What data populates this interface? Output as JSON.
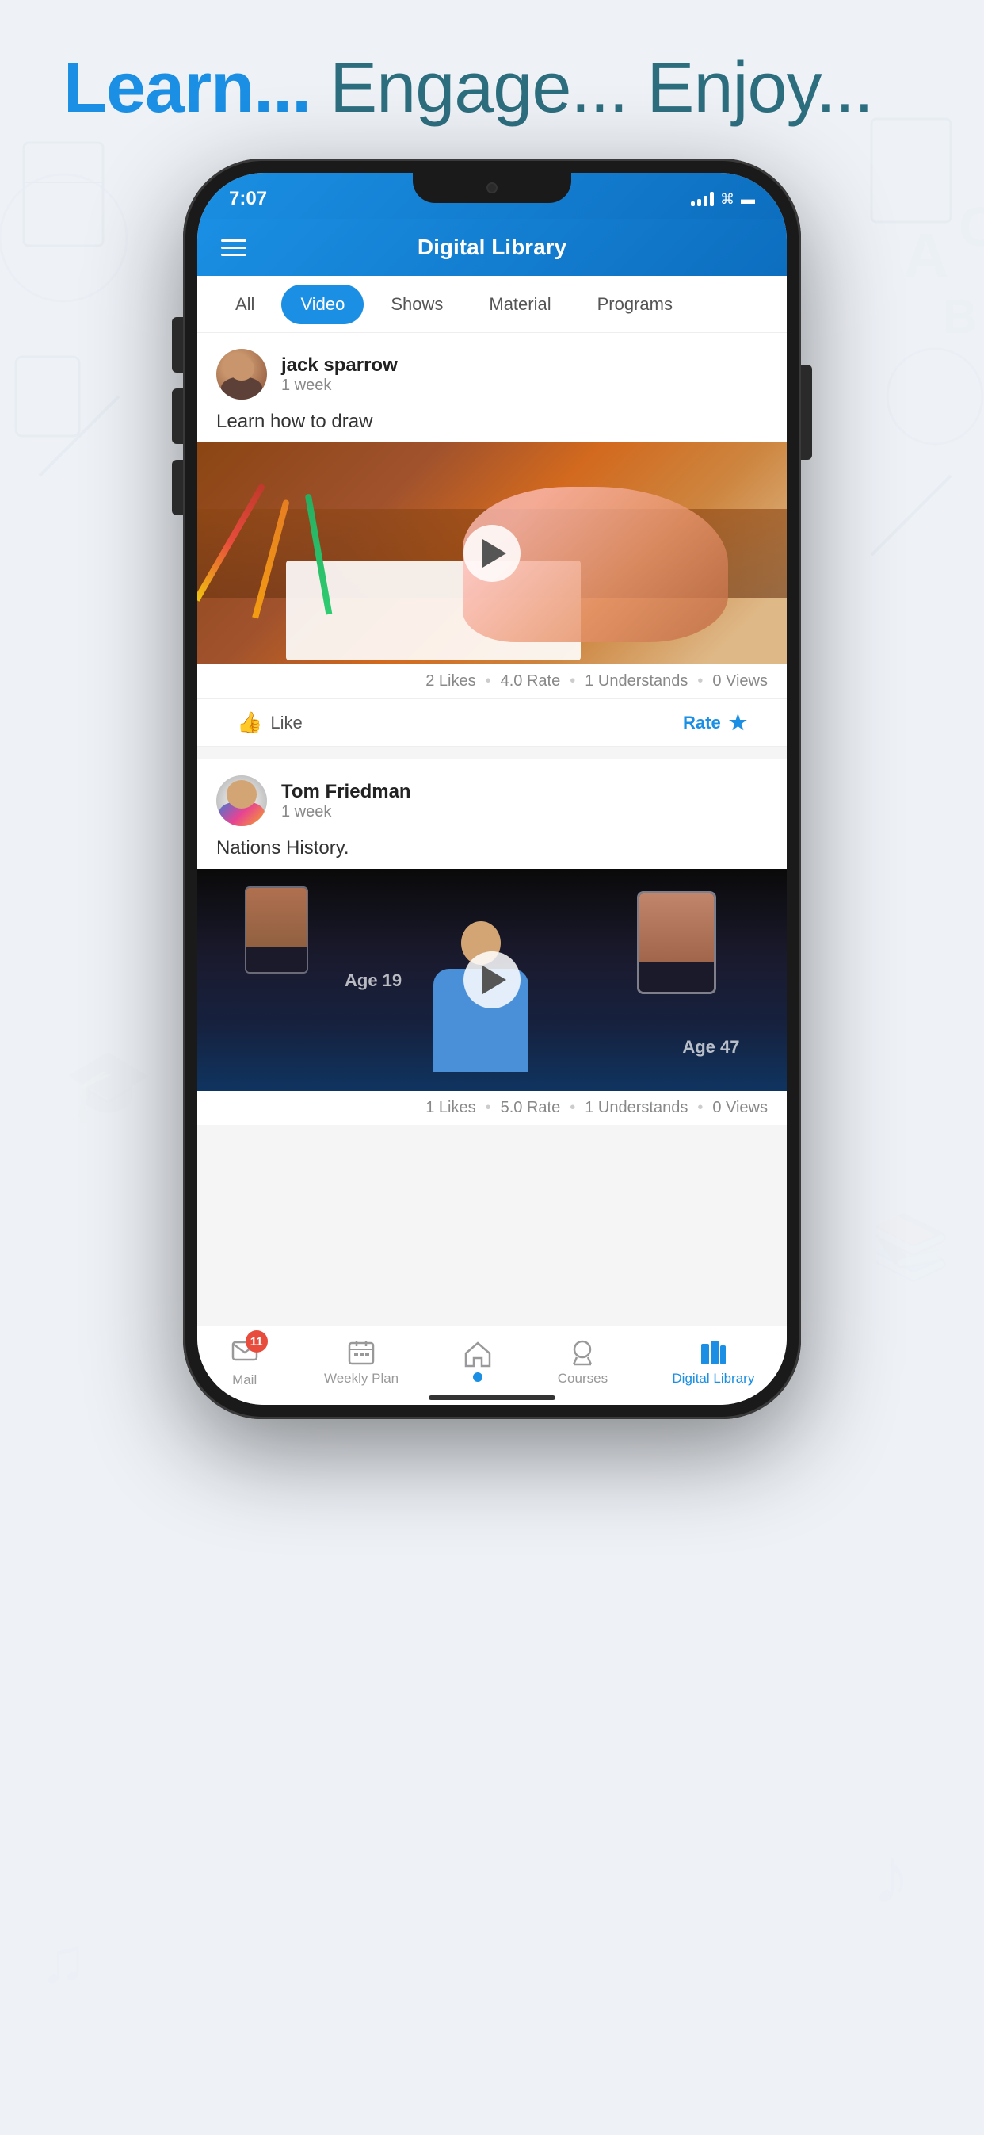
{
  "headline": {
    "learn": "Learn...",
    "rest": " Engage... Enjoy..."
  },
  "phone": {
    "status": {
      "time": "7:07"
    },
    "header": {
      "title": "Digital Library"
    },
    "tabs": [
      {
        "id": "all",
        "label": "All",
        "active": false
      },
      {
        "id": "video",
        "label": "Video",
        "active": true
      },
      {
        "id": "shows",
        "label": "Shows",
        "active": false
      },
      {
        "id": "material",
        "label": "Material",
        "active": false
      },
      {
        "id": "programs",
        "label": "Programs",
        "active": false
      }
    ],
    "posts": [
      {
        "id": "post1",
        "author": "jack sparrow",
        "time": "1 week",
        "title": "Learn how to draw",
        "stats": {
          "likes": "2 Likes",
          "rate": "4.0 Rate",
          "understands": "1 Understands",
          "views": "0 Views"
        },
        "actions": {
          "like": "Like",
          "rate": "Rate"
        }
      },
      {
        "id": "post2",
        "author": "Tom Friedman",
        "time": "1 week",
        "title": "Nations History.",
        "stats": {
          "likes": "1 Likes",
          "rate": "5.0 Rate",
          "understands": "1 Understands",
          "views": "0 Views"
        }
      }
    ],
    "bottomNav": [
      {
        "id": "mail",
        "label": "Mail",
        "badge": "11",
        "active": false
      },
      {
        "id": "weekly",
        "label": "Weekly Plan",
        "active": false
      },
      {
        "id": "home",
        "label": "",
        "active": false
      },
      {
        "id": "courses",
        "label": "Courses",
        "active": false
      },
      {
        "id": "library",
        "label": "Digital Library",
        "active": true
      }
    ]
  }
}
